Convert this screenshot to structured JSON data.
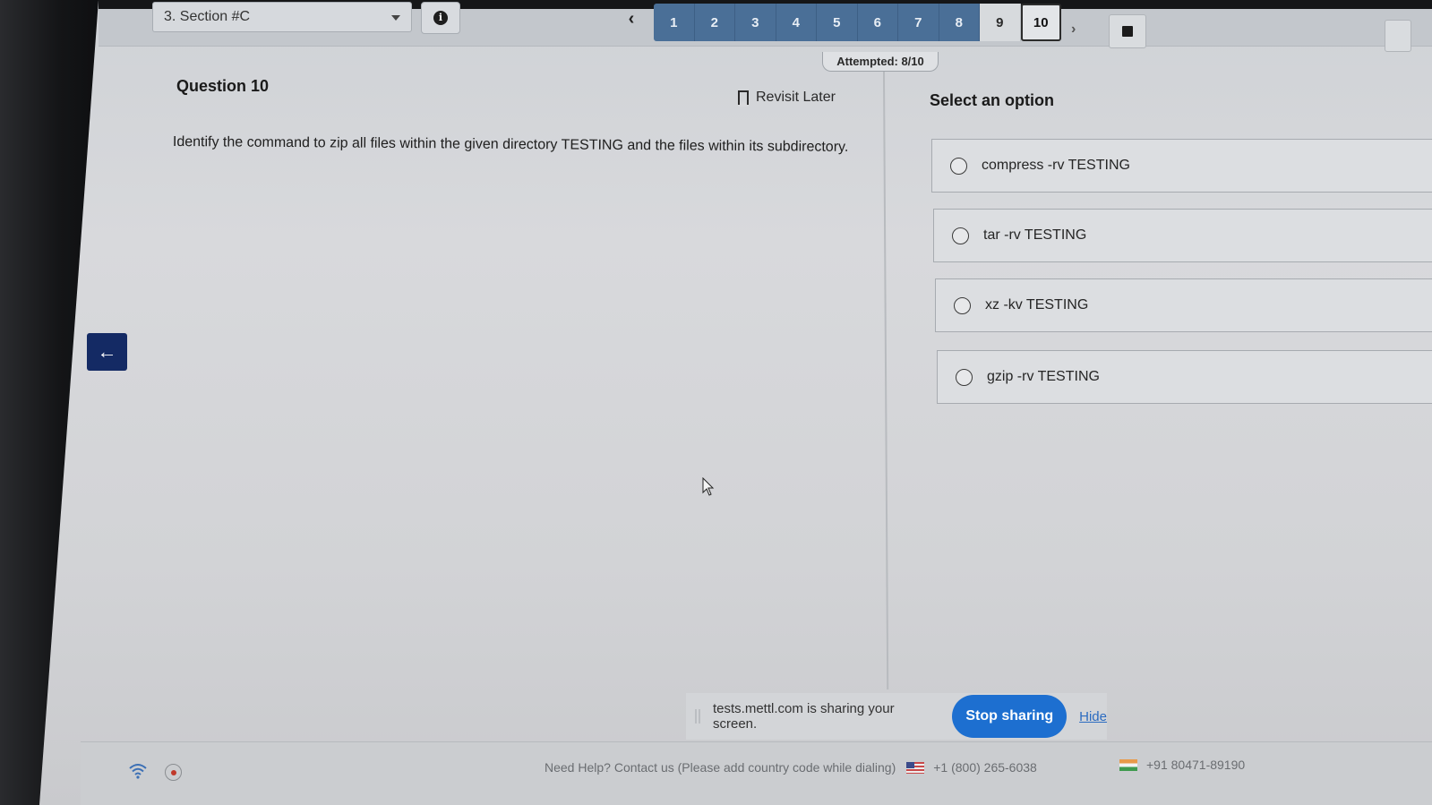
{
  "header": {
    "section_label": "3. Section #C",
    "questions": [
      "1",
      "2",
      "3",
      "4",
      "5",
      "6",
      "7",
      "8",
      "9",
      "10"
    ],
    "attempted": "Attempted: 8/10"
  },
  "question": {
    "title": "Question 10",
    "revisit_label": "Revisit Later",
    "text": "Identify the command to zip all files within the given directory TESTING and the files within its subdirectory."
  },
  "options": {
    "title": "Select an option",
    "items": [
      {
        "label": "compress -rv TESTING"
      },
      {
        "label": "tar -rv TESTING"
      },
      {
        "label": "xz -kv TESTING"
      },
      {
        "label": "gzip -rv TESTING"
      }
    ]
  },
  "share_bar": {
    "text": "tests.mettl.com is sharing your screen.",
    "stop_label": "Stop sharing",
    "hide_label": "Hide"
  },
  "footer": {
    "help_text": "Need Help? Contact us (Please add country code while dialing)",
    "phone_us": "+1 (800) 265-6038",
    "phone_in": "+91 80471-89190"
  },
  "colors": {
    "attempted_blue": "#4a6f97",
    "back_button_navy": "#142a64",
    "stop_sharing_blue": "#1d6fd0"
  }
}
